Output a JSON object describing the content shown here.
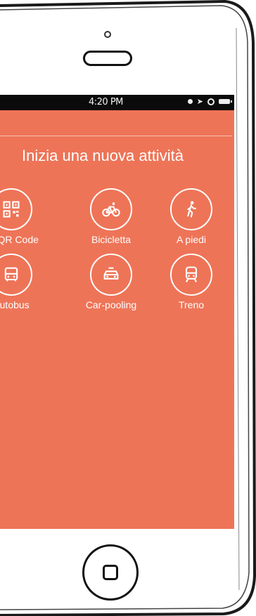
{
  "status_bar": {
    "time": "4:20 PM"
  },
  "screen": {
    "title": "Inizia una nuova attività",
    "background_color": "#ee7457",
    "activities": [
      {
        "label": "an QR Code",
        "icon": "qr-code-icon"
      },
      {
        "label": "Bicicletta",
        "icon": "bicycle-icon"
      },
      {
        "label": "A piedi",
        "icon": "walking-icon"
      },
      {
        "label": "Autobus",
        "icon": "bus-icon"
      },
      {
        "label": "Car-pooling",
        "icon": "car-icon"
      },
      {
        "label": "Treno",
        "icon": "train-icon"
      }
    ]
  }
}
